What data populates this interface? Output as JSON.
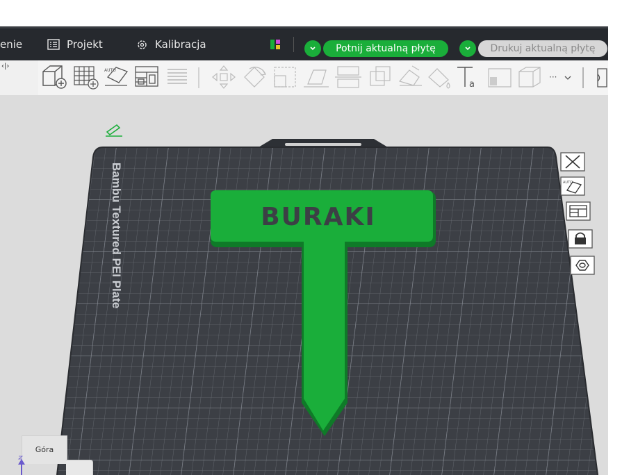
{
  "menu": {
    "partial_label": "enie",
    "project_label": "Projekt",
    "calibration_label": "Kalibracja",
    "slice_button": "Potnij aktualną płytę",
    "print_button": "Drukuj aktualną płytę"
  },
  "panel": {
    "collapse_glyph": "‹|›"
  },
  "toolbar": {
    "more_label": "···"
  },
  "plate": {
    "label": "Bambu Textured PEI Plate"
  },
  "model": {
    "text": "BURAKI",
    "color": "#1aae3a"
  },
  "view": {
    "orientation_label": "Góra"
  },
  "colors": {
    "accent": "#1aae3a",
    "menubar": "#26292e",
    "plate": "#3c3f45"
  }
}
